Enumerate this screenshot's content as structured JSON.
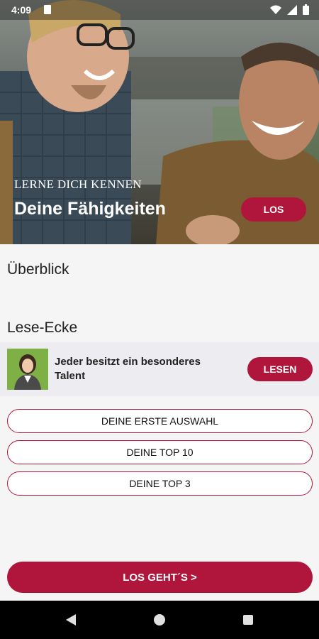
{
  "status_bar": {
    "time": "4:09"
  },
  "hero": {
    "kicker": "LERNE DICH KENNEN",
    "title": "Deine Fähigkeiten",
    "button_label": "LOS"
  },
  "overview": {
    "title": "Überblick"
  },
  "reading": {
    "title": "Lese-Ecke",
    "card_text": "Jeder besitzt ein besonderes Talent",
    "button_label": "LESEN"
  },
  "options": [
    {
      "label": "DEINE ERSTE AUSWAHL"
    },
    {
      "label": "DEINE TOP 10"
    },
    {
      "label": "DEINE TOP 3"
    }
  ],
  "cta": {
    "label": "LOS GEHT´S >"
  },
  "colors": {
    "accent": "#b0163b",
    "card_bg": "#ececf1",
    "page_bg": "#f5f5f5"
  },
  "icons": {
    "status": [
      "sd-card-icon",
      "wifi-icon",
      "signal-icon",
      "battery-icon"
    ],
    "nav": [
      "back-icon",
      "home-icon",
      "recents-icon"
    ]
  }
}
